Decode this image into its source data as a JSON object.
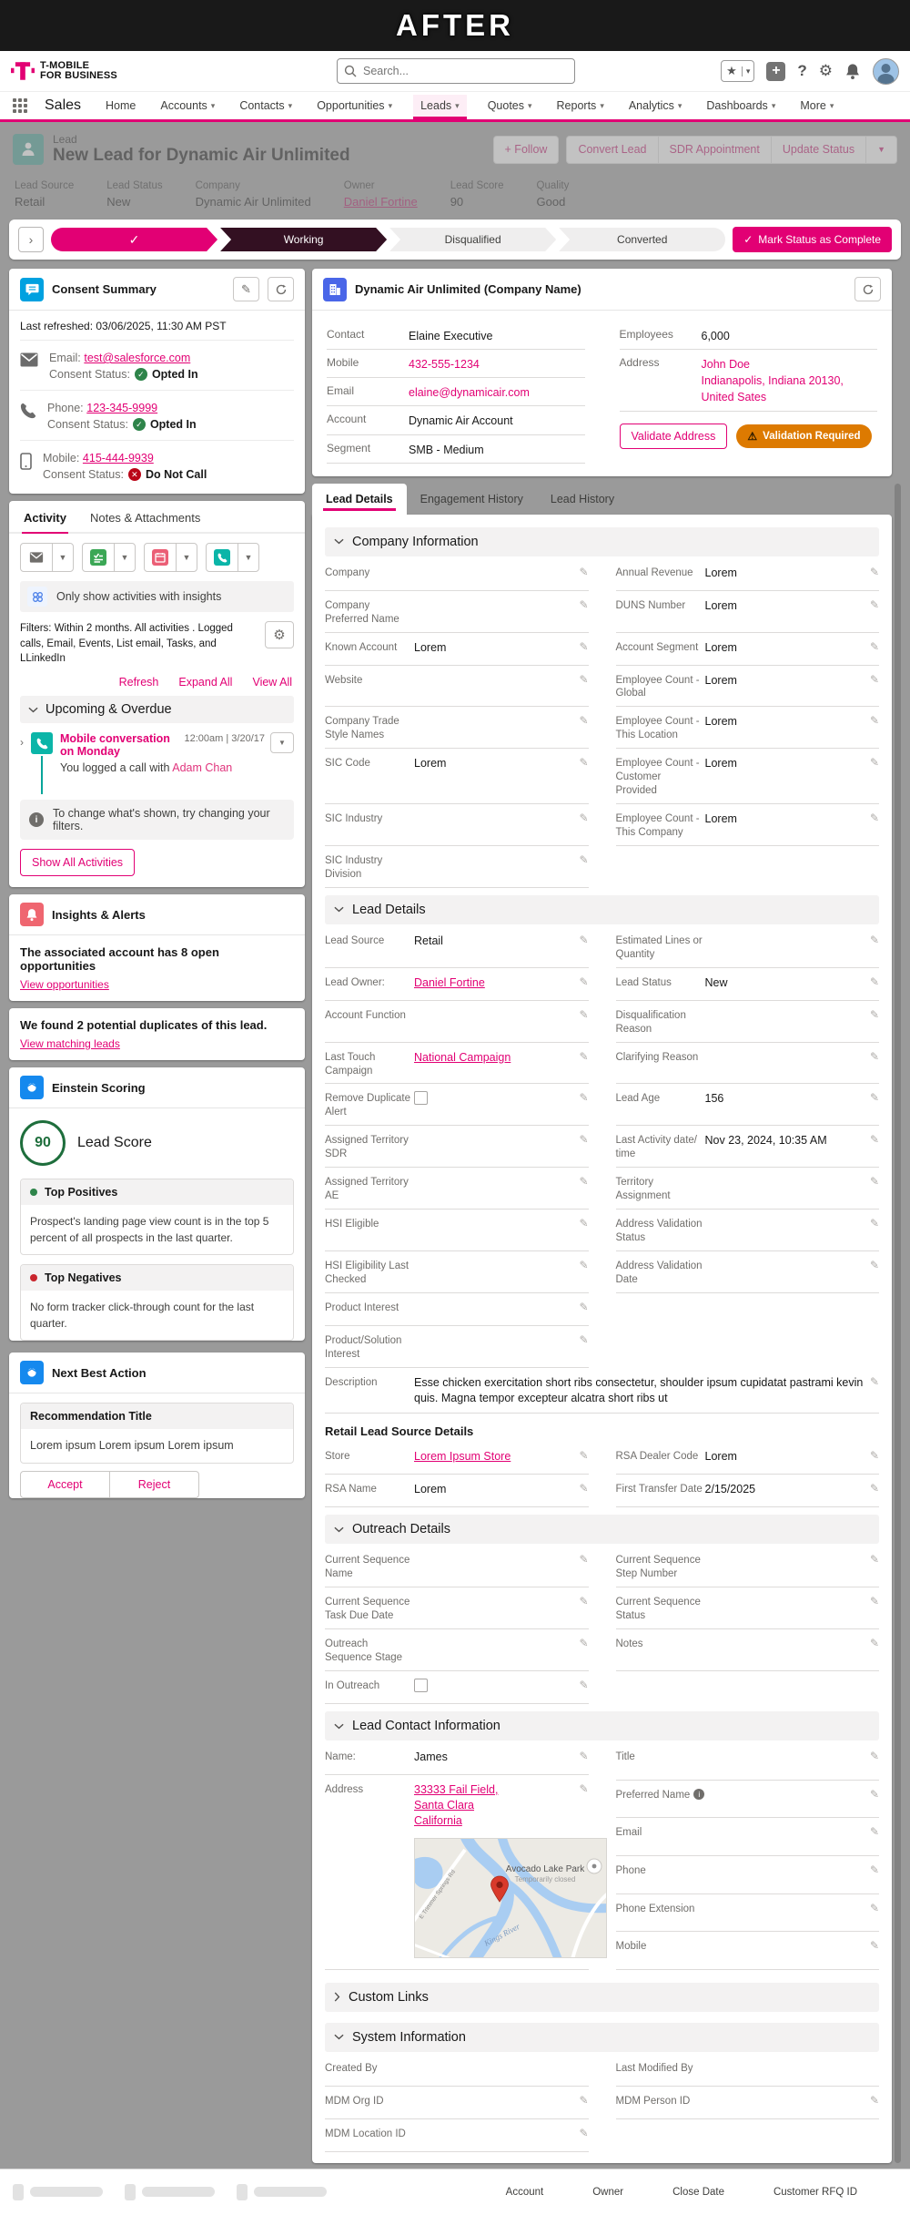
{
  "banner": {
    "title": "AFTER"
  },
  "header": {
    "logo_line1": "T-MOBILE",
    "logo_line2": "FOR BUSINESS",
    "search_placeholder": "Search..."
  },
  "glyphs": {
    "caret_down": "▾",
    "caret_down_big": "▼",
    "star": "★",
    "plus": "+",
    "help": "?",
    "gear": "⚙",
    "check": "✓",
    "x_mark": "✕",
    "chevron_right": "›",
    "pencil": "✎",
    "warning": "⚠",
    "info_i": "i"
  },
  "icons": {
    "search-icon": "magnifier glyph",
    "favorites-star-icon": "star in bordered box with caret",
    "quick-add-icon": "white plus on gray tile",
    "help-icon": "question mark",
    "setup-gear-icon": "gear",
    "notifications-bell-icon": "bell",
    "user-avatar": "circular profile photo",
    "app-launcher-icon": "3x3 dot waffle",
    "lead-record-icon": "teal person tile",
    "consent-icon": "blue chat-bubble tile",
    "account-building-icon": "blue building tile",
    "alerts-bell-icon": "red bell tile",
    "einstein-icon": "blue einstein-head tile",
    "email-icon": "gray envelope",
    "new-task-icon": "green checklist tile",
    "new-event-icon": "pink calendar tile",
    "log-call-icon": "teal phone tile",
    "phone-icon": "gray handset",
    "mobile-icon": "gray smartphone outline",
    "refresh-icon": "circular arrow",
    "edit-pencil-icon": "pencil",
    "map-pin-icon": "red teardrop marker"
  },
  "nav": {
    "app_name": "Sales",
    "items": [
      {
        "label": "Home"
      },
      {
        "label": "Accounts"
      },
      {
        "label": "Contacts"
      },
      {
        "label": "Opportunities"
      },
      {
        "label": "Leads"
      },
      {
        "label": "Quotes"
      },
      {
        "label": "Reports"
      },
      {
        "label": "Analytics"
      },
      {
        "label": "Dashboards"
      },
      {
        "label": "More"
      }
    ]
  },
  "page_header": {
    "entity": "Lead",
    "title": "New Lead for Dynamic Air Unlimited",
    "follow_label": "+ Follow",
    "buttons": [
      "Convert Lead",
      "SDR Appointment",
      "Update Status"
    ],
    "fields": [
      {
        "label": "Lead Source",
        "value": "Retail"
      },
      {
        "label": "Lead Status",
        "value": "New"
      },
      {
        "label": "Company",
        "value": "Dynamic Air Unlimited"
      },
      {
        "label": "Owner",
        "value": "Daniel Fortine"
      },
      {
        "label": "Lead Score",
        "value": "90"
      },
      {
        "label": "Quality",
        "value": "Good"
      }
    ]
  },
  "path": {
    "stages": [
      {
        "label": "",
        "state": "complete"
      },
      {
        "label": "Working",
        "state": "current"
      },
      {
        "label": "Disqualified",
        "state": "incomplete"
      },
      {
        "label": "Converted",
        "state": "incomplete"
      }
    ],
    "mark_complete_label": "Mark Status as Complete"
  },
  "consent": {
    "title": "Consent Summary",
    "last_refreshed": "Last refreshed: 03/06/2025, 11:30 AM PST",
    "status_label": "Consent Status:",
    "items": [
      {
        "channel": "Email:",
        "value": "test@salesforce.com",
        "status": "Opted In",
        "status_type": "ok"
      },
      {
        "channel": "Phone:",
        "value": "123-345-9999",
        "status": "Opted In",
        "status_type": "ok"
      },
      {
        "channel": "Mobile:",
        "value": "415-444-9939",
        "status": "Do Not Call",
        "status_type": "blocked"
      }
    ]
  },
  "company_panel": {
    "title": "Dynamic Air Unlimited (Company Name)",
    "fields_left": [
      {
        "label": "Contact",
        "value": "Elaine Executive"
      },
      {
        "label": "Mobile",
        "value": "432-555-1234"
      },
      {
        "label": "Email",
        "value": "elaine@dynamicair.com"
      },
      {
        "label": "Account",
        "value": "Dynamic Air Account"
      },
      {
        "label": "Segment",
        "value": "SMB - Medium"
      }
    ],
    "employees_label": "Employees",
    "employees_value": "6,000",
    "address_label": "Address",
    "address_value": "John Doe\nIndianapolis, Indiana 20130,\nUnited Sates",
    "validate_button": "Validate Address",
    "validation_badge": "Validation Required"
  },
  "activity": {
    "tabs": [
      "Activity",
      "Notes & Attachments"
    ],
    "insights_filter_label": "Only show activities with insights",
    "filters_text": "Filters: Within 2 months. All activities . Logged calls, Email, Events, List email, Tasks, and LLinkedIn",
    "links": [
      "Refresh",
      "Expand All",
      "View All"
    ],
    "section_title": "Upcoming & Overdue",
    "item": {
      "title": "Mobile conversation on Monday",
      "time": "12:00am | 3/20/17",
      "body_prefix": "You logged a call with ",
      "body_link": "Adam Chan"
    },
    "info_text": "To change what's shown, try changing your filters.",
    "show_all_label": "Show All Activities"
  },
  "insights": {
    "title": "Insights & Alerts",
    "alert_text": "The associated account has 8 open opportunities",
    "alert_link": "View opportunities",
    "duplicates_text": "We found 2 potential duplicates of this lead.",
    "duplicates_link": "View matching leads"
  },
  "einstein_scoring": {
    "title": "Einstein Scoring",
    "score": "90",
    "score_label": "Lead Score",
    "positives_title": "Top Positives",
    "positives_text": "Prospect's landing page view count is in the top 5 percent of all prospects in the last quarter.",
    "negatives_title": "Top Negatives",
    "negatives_text": "No form tracker click-through count for the last quarter."
  },
  "next_best_action": {
    "title": "Next Best Action",
    "recommendation_title": "Recommendation Title",
    "recommendation_text": "Lorem ipsum Lorem ipsum Lorem ipsum",
    "accept_label": "Accept",
    "reject_label": "Reject"
  },
  "record_tabs": [
    "Lead Details",
    "Engagement History",
    "Lead History"
  ],
  "sections": {
    "company_info": {
      "title": "Company Information",
      "rows": [
        {
          "l": {
            "label": "Company",
            "value": ""
          },
          "r": {
            "label": "Annual Revenue",
            "value": "Lorem"
          }
        },
        {
          "l": {
            "label": "Company Preferred Name",
            "value": ""
          },
          "r": {
            "label": "DUNS Number",
            "value": "Lorem"
          }
        },
        {
          "l": {
            "label": "Known Account",
            "value": "Lorem"
          },
          "r": {
            "label": "Account Segment",
            "value": "Lorem"
          }
        },
        {
          "l": {
            "label": "Website",
            "value": ""
          },
          "r": {
            "label": "Employee Count - Global",
            "value": "Lorem"
          }
        },
        {
          "l": {
            "label": "Company Trade Style Names",
            "value": ""
          },
          "r": {
            "label": "Employee Count - This Location",
            "value": "Lorem"
          }
        },
        {
          "l": {
            "label": "SIC Code",
            "value": "Lorem"
          },
          "r": {
            "label": "Employee Count - Customer Provided",
            "value": "Lorem"
          }
        },
        {
          "l": {
            "label": "SIC Industry",
            "value": ""
          },
          "r": {
            "label": "Employee Count - This Company",
            "value": "Lorem"
          }
        },
        {
          "l": {
            "label": "SIC Industry Division",
            "value": ""
          },
          "r": null
        }
      ]
    },
    "lead_details": {
      "title": "Lead Details",
      "rows": [
        {
          "l": {
            "label": "Lead Source",
            "value": "Retail"
          },
          "r": {
            "label": "Estimated Lines or Quantity",
            "value": ""
          }
        },
        {
          "l": {
            "label": "Lead Owner:",
            "value": "Daniel Fortine",
            "type": "link"
          },
          "r": {
            "label": "Lead Status",
            "value": "New"
          }
        },
        {
          "l": {
            "label": "Account Function",
            "value": ""
          },
          "r": {
            "label": "Disqualification Reason",
            "value": ""
          }
        },
        {
          "l": {
            "label": "Last Touch Campaign",
            "value": "National Campaign",
            "type": "link"
          },
          "r": {
            "label": "Clarifying Reason",
            "value": ""
          }
        },
        {
          "l": {
            "label": "Remove Duplicate Alert",
            "type": "checkbox"
          },
          "r": {
            "label": "Lead Age",
            "value": "156"
          }
        },
        {
          "l": {
            "label": "Assigned Territory SDR",
            "value": ""
          },
          "r": {
            "label": "Last Activity date/ time",
            "value": "Nov 23, 2024, 10:35 AM"
          }
        },
        {
          "l": {
            "label": "Assigned Territory AE",
            "value": ""
          },
          "r": {
            "label": "Territory Assignment",
            "value": ""
          }
        },
        {
          "l": {
            "label": "HSI Eligible",
            "value": ""
          },
          "r": {
            "label": "Address Validation Status",
            "value": ""
          }
        },
        {
          "l": {
            "label": "HSI Eligibility Last Checked",
            "value": ""
          },
          "r": {
            "label": "Address Validation Date",
            "value": ""
          }
        },
        {
          "l": {
            "label": "Product Interest",
            "value": ""
          },
          "r": null
        },
        {
          "l": {
            "label": "Product/Solution Interest",
            "value": ""
          },
          "r": null
        }
      ],
      "description": {
        "label": "Description",
        "value": "Esse chicken exercitation short ribs consectetur, shoulder ipsum cupidatat pastrami kevin quis. Magna tempor excepteur alcatra short ribs ut"
      }
    },
    "retail": {
      "title": "Retail Lead Source Details",
      "rows": [
        {
          "l": {
            "label": "Store",
            "value": "Lorem Ipsum Store",
            "type": "link"
          },
          "r": {
            "label": "RSA Dealer Code",
            "value": "Lorem"
          }
        },
        {
          "l": {
            "label": "RSA Name",
            "value": "Lorem"
          },
          "r": {
            "label": "First Transfer Date",
            "value": "2/15/2025"
          }
        }
      ]
    },
    "outreach": {
      "title": "Outreach Details",
      "rows": [
        {
          "l": {
            "label": "Current Sequence Name",
            "value": ""
          },
          "r": {
            "label": "Current Sequence Step Number",
            "value": ""
          }
        },
        {
          "l": {
            "label": "Current Sequence Task Due Date",
            "value": ""
          },
          "r": {
            "label": "Current Sequence Status",
            "value": ""
          }
        },
        {
          "l": {
            "label": "Outreach Sequence Stage",
            "value": ""
          },
          "r": {
            "label": "Notes",
            "value": ""
          }
        },
        {
          "l": {
            "label": "In Outreach",
            "type": "checkbox"
          },
          "r": null
        }
      ]
    },
    "contact": {
      "title": "Lead Contact Information",
      "name_cells": [
        {
          "label": "Name:",
          "value": "James"
        }
      ],
      "address_label": "Address",
      "address_value": "33333 Fail Field,\nSanta Clara\nCalifornia",
      "right_cells": [
        {
          "label": "Title",
          "value": ""
        },
        {
          "label": "Preferred Name",
          "value": "",
          "info": true
        },
        {
          "label": "Email",
          "value": ""
        },
        {
          "label": "Phone",
          "value": ""
        },
        {
          "label": "Phone Extension",
          "value": ""
        },
        {
          "label": "Mobile",
          "value": ""
        }
      ],
      "map": {
        "park_label": "Avocado Lake Park",
        "park_status": "Temporarily closed",
        "river_label": "Kings River",
        "road_label": "E Trimmer Springs Rd"
      }
    },
    "custom_links": {
      "title": "Custom Links"
    },
    "system": {
      "title": "System Information",
      "rows": [
        {
          "l": {
            "label": "Created By",
            "value": "",
            "edit": false
          },
          "r": {
            "label": "Last Modified By",
            "value": "",
            "edit": false
          }
        },
        {
          "l": {
            "label": "MDM Org ID",
            "value": ""
          },
          "r": {
            "label": "MDM Person ID",
            "value": ""
          }
        },
        {
          "l": {
            "label": "MDM Location ID",
            "value": ""
          },
          "r": null
        }
      ]
    }
  },
  "footer": {
    "labels": [
      "Account",
      "Owner",
      "Close Date",
      "Customer RFQ ID"
    ]
  }
}
